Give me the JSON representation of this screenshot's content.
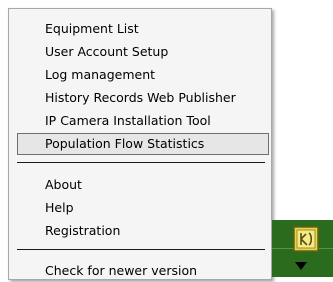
{
  "menu": {
    "items": [
      {
        "label": "Equipment List"
      },
      {
        "label": "User Account Setup"
      },
      {
        "label": "Log management"
      },
      {
        "label": "History Records Web Publisher"
      },
      {
        "label": "IP Camera Installation Tool"
      },
      {
        "label": "Population Flow Statistics"
      },
      {
        "label": "About"
      },
      {
        "label": "Help"
      },
      {
        "label": "Registration"
      },
      {
        "label": "Check for newer version"
      }
    ],
    "selected_item": "Population Flow Statistics"
  },
  "colors": {
    "menu_background": "#f5f5f5",
    "selected_background": "#e6e6e6",
    "taskbar_green": "#2b6b1e",
    "icon_yellow": "#e8d64a"
  },
  "icons": {
    "tray": "app-tray-icon",
    "expand": "arrow-down-icon"
  }
}
